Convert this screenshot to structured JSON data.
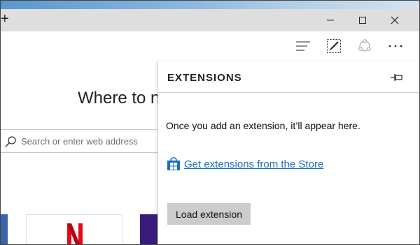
{
  "window": {
    "new_tab_label": "+",
    "minimize_label": "Minimize",
    "maximize_label": "Maximize",
    "close_label": "Close"
  },
  "toolbar": {
    "icons": [
      "hub-icon",
      "web-note-icon",
      "share-icon",
      "more-icon"
    ]
  },
  "page": {
    "heading": "Where to n",
    "search_placeholder": "Search or enter web address"
  },
  "extensions_panel": {
    "title": "EXTENSIONS",
    "empty_message": "Once you add an extension, it’ll appear here.",
    "store_link": "Get extensions from the Store",
    "load_button": "Load extension"
  },
  "colors": {
    "link": "#1a6ec0",
    "button_bg": "#cccccc",
    "titlebar_bg": "#dedede",
    "netflix_red": "#e50914"
  }
}
